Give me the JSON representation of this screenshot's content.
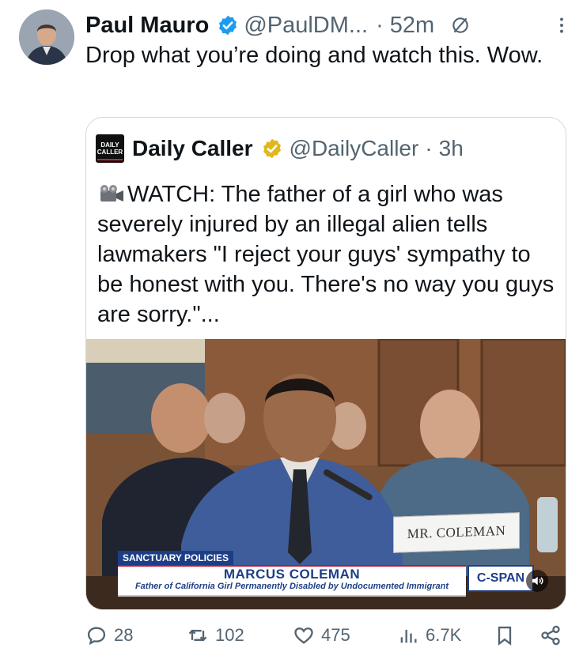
{
  "tweet": {
    "author_name": "Paul Mauro",
    "author_handle": "@PaulDM...",
    "separator": "·",
    "time": "52m",
    "text": "Drop what you’re doing and watch this. Wow."
  },
  "quote": {
    "logo_text_line1": "DAILY",
    "logo_text_line2": "CALLER",
    "author_name": "Daily Caller",
    "author_handle": "@DailyCaller",
    "separator": "·",
    "time": "3h",
    "text": "WATCH: The father of a girl who was severely injured by an illegal alien tells lawmakers \"I reject your guys' sympathy to be honest with you. There's no way you guys are sorry.\"..."
  },
  "video": {
    "nameplate": "MR. COLEMAN",
    "ticker_tag": "SANCTUARY POLICIES",
    "lower_third_name": "MARCUS COLEMAN",
    "lower_third_sub": "Father of California Girl Permanently Disabled by Undocumented Immigrant",
    "network_logo": "C-SPAN"
  },
  "actions": {
    "replies": "28",
    "reposts": "102",
    "likes": "475",
    "views": "6.7K"
  },
  "colors": {
    "verified_blue": "#1d9bf0",
    "verified_gold": "#e2b719",
    "secondary_text": "#536471",
    "cspan_blue": "#1d3e86"
  }
}
